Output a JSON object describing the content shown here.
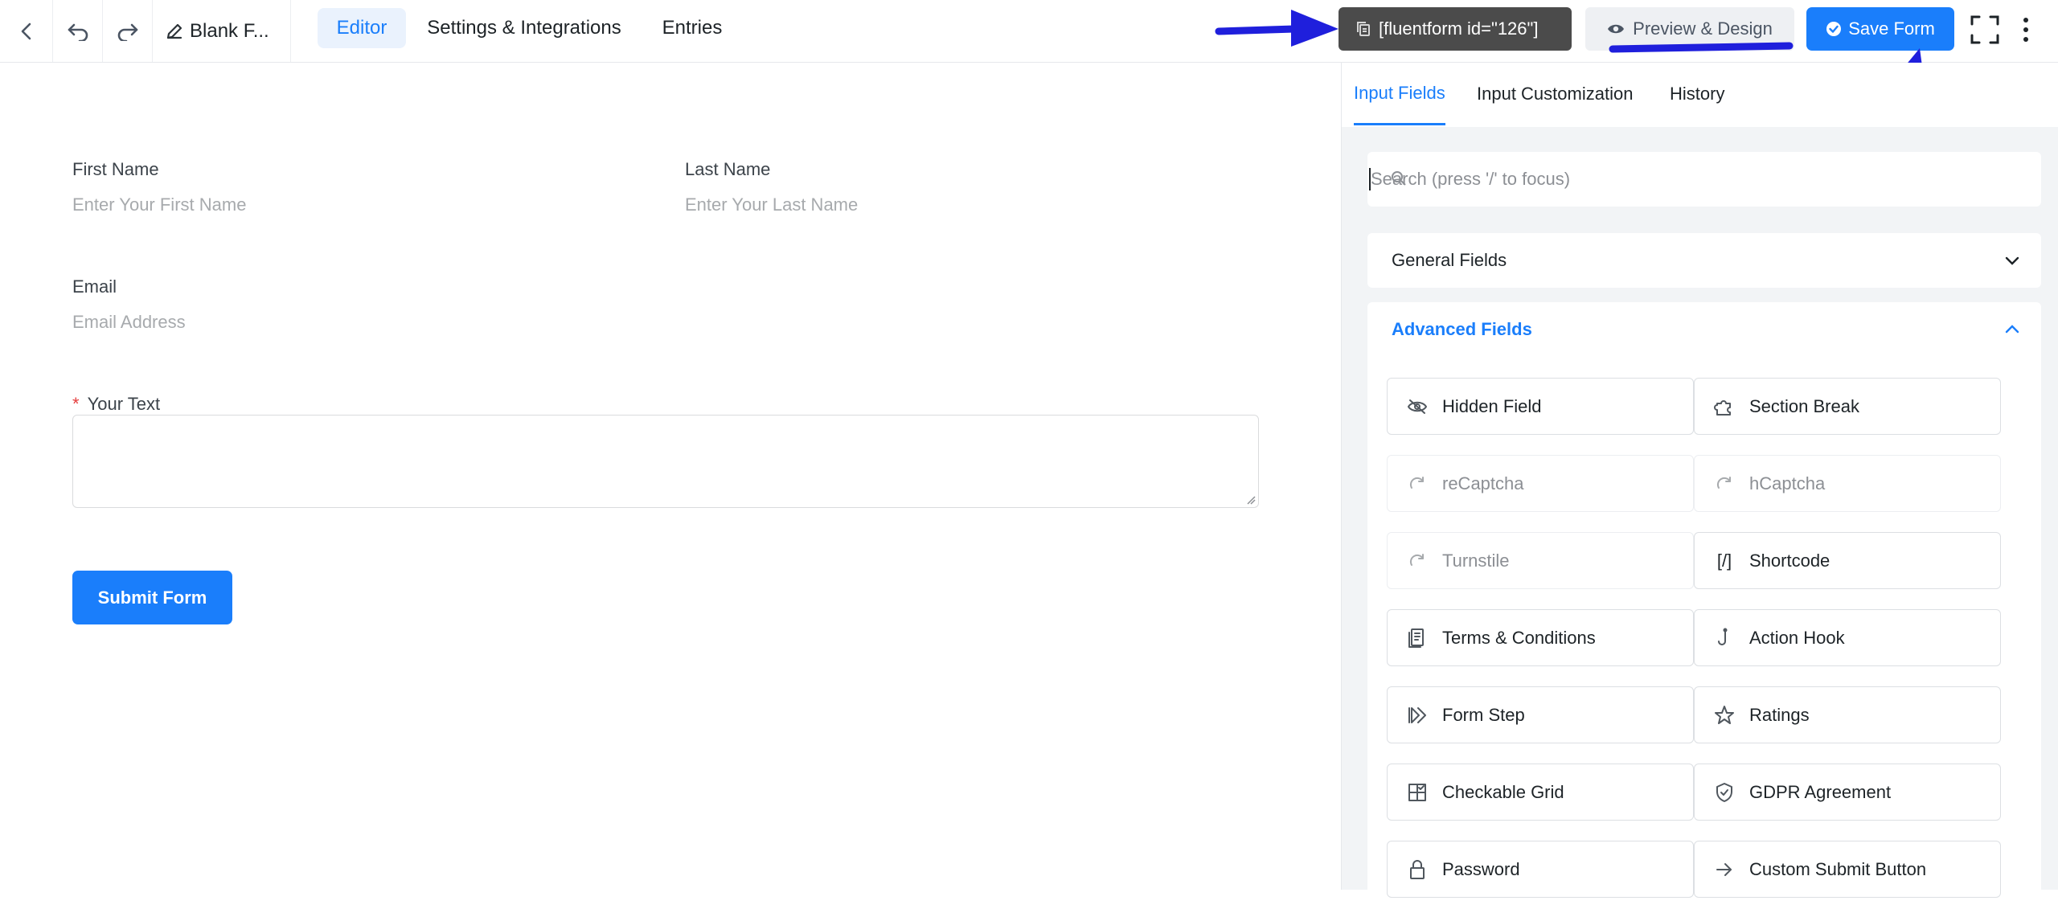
{
  "header": {
    "title": "Blank F...",
    "tabs": [
      "Editor",
      "Settings & Integrations",
      "Entries"
    ],
    "shortcode": "[fluentform id=\"126\"]",
    "preview_label": "Preview & Design",
    "save_label": "Save Form"
  },
  "form": {
    "first_name_label": "First Name",
    "first_name_placeholder": "Enter Your First Name",
    "last_name_label": "Last Name",
    "last_name_placeholder": "Enter Your Last Name",
    "email_label": "Email",
    "email_placeholder": "Email Address",
    "required_mark": "*",
    "text_label": "Your Text",
    "submit_label": "Submit Form"
  },
  "panel": {
    "tabs": [
      "Input Fields",
      "Input Customization",
      "History"
    ],
    "search_placeholder": "Search (press '/' to focus)",
    "general_fields": "General Fields",
    "advanced_fields": "Advanced Fields",
    "fields": [
      {
        "label": "Hidden Field",
        "icon": "eye-slash-icon"
      },
      {
        "label": "Section Break",
        "icon": "puzzle-icon"
      },
      {
        "label": "reCaptcha",
        "icon": "captcha-icon"
      },
      {
        "label": "hCaptcha",
        "icon": "captcha-icon"
      },
      {
        "label": "Turnstile",
        "icon": "captcha-icon"
      },
      {
        "label": "Shortcode",
        "icon": "shortcode-icon",
        "glyph": "[/]"
      },
      {
        "label": "Terms & Conditions",
        "icon": "document-icon"
      },
      {
        "label": "Action Hook",
        "icon": "hook-icon"
      },
      {
        "label": "Form Step",
        "icon": "step-icon"
      },
      {
        "label": "Ratings",
        "icon": "star-icon"
      },
      {
        "label": "Checkable Grid",
        "icon": "grid-icon"
      },
      {
        "label": "GDPR Agreement",
        "icon": "shield-icon"
      },
      {
        "label": "Password",
        "icon": "lock-icon"
      },
      {
        "label": "Custom Submit Button",
        "icon": "arrow-right-icon"
      }
    ]
  },
  "colors": {
    "accent": "#1a7efb",
    "shortcode_bg": "#4b4b4b",
    "annotation": "#1f1fdc"
  }
}
